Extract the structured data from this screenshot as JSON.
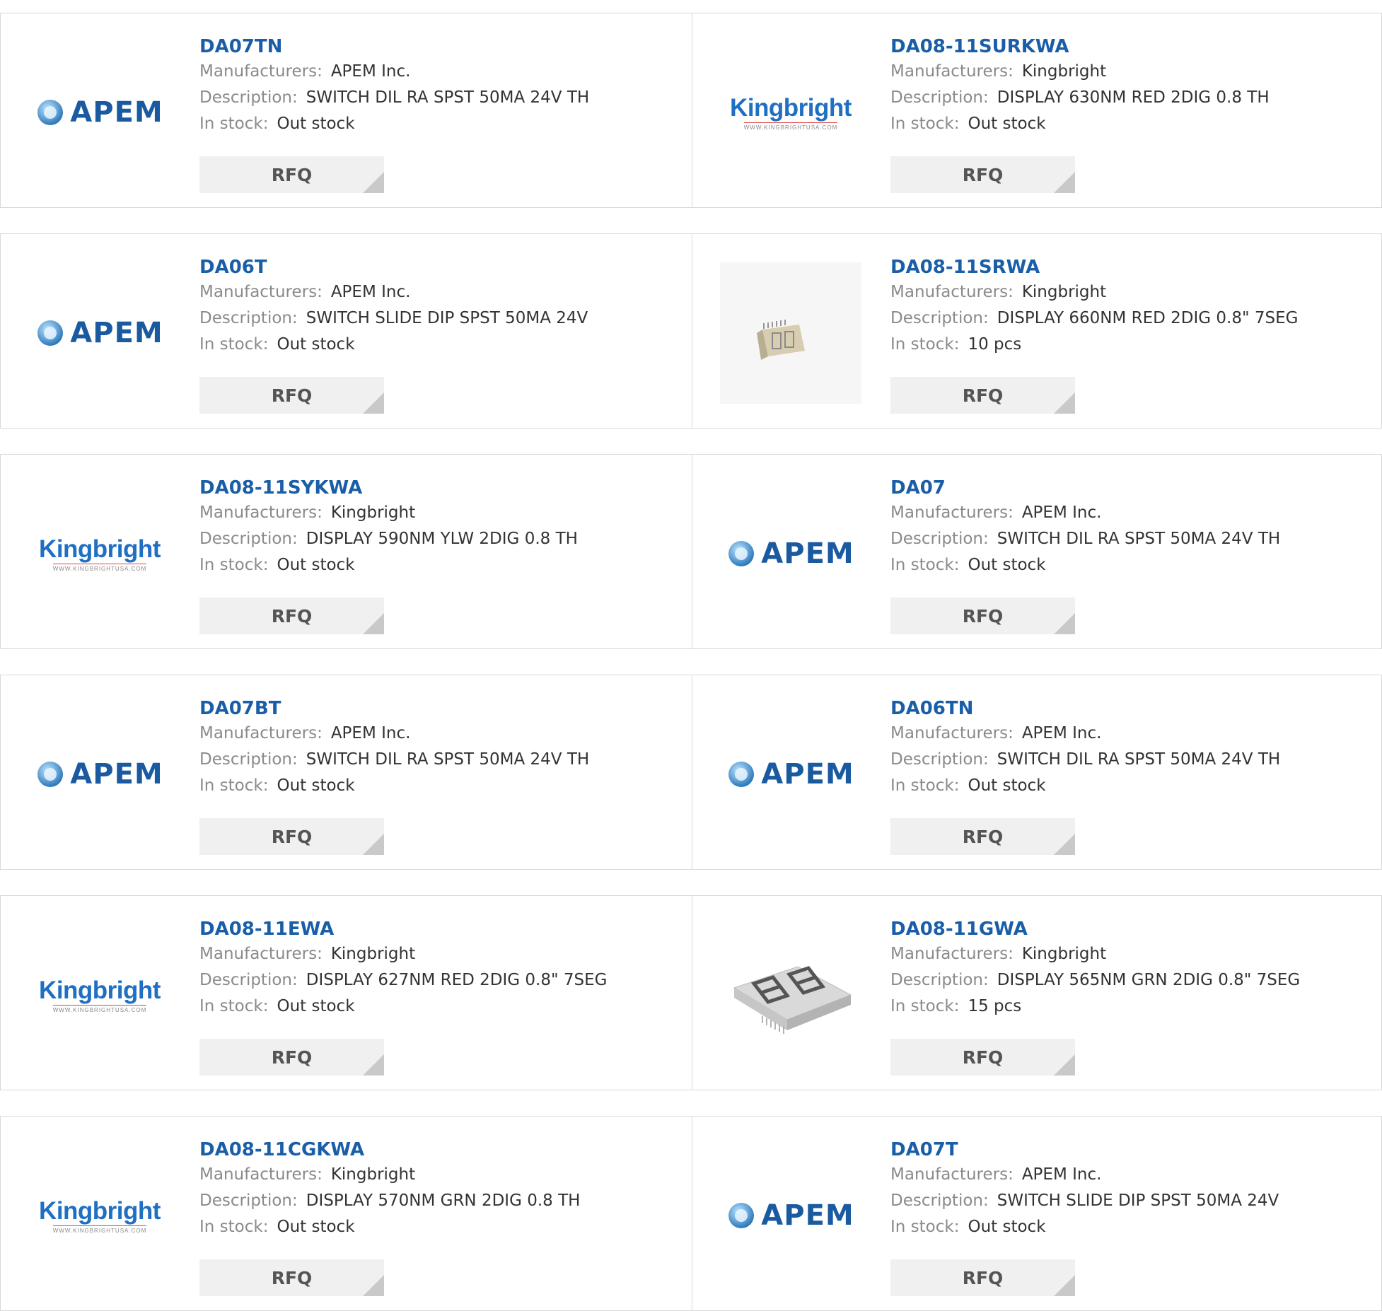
{
  "labels": {
    "manufacturers": "Manufacturers:",
    "description": "Description:",
    "in_stock": "In stock:",
    "rfq": "RFQ"
  },
  "products": [
    {
      "part": "DA07TN",
      "manufacturer": "APEM Inc.",
      "description": "SWITCH DIL RA SPST 50MA 24V TH",
      "stock": "Out stock",
      "logo": "apem-logo"
    },
    {
      "part": "DA08-11SURKWA",
      "manufacturer": "Kingbright",
      "description": "DISPLAY 630NM RED 2DIG 0.8 TH",
      "stock": "Out stock",
      "logo": "kingbright-logo"
    },
    {
      "part": "DA06T",
      "manufacturer": "APEM Inc.",
      "description": "SWITCH SLIDE DIP SPST 50MA 24V",
      "stock": "Out stock",
      "logo": "apem-logo"
    },
    {
      "part": "DA08-11SRWA",
      "manufacturer": "Kingbright",
      "description": "DISPLAY 660NM RED 2DIG 0.8\" 7SEG",
      "stock": "10 pcs",
      "logo": "small-display-photo"
    },
    {
      "part": "DA08-11SYKWA",
      "manufacturer": "Kingbright",
      "description": "DISPLAY 590NM YLW 2DIG 0.8 TH",
      "stock": "Out stock",
      "logo": "kingbright-logo"
    },
    {
      "part": "DA07",
      "manufacturer": "APEM Inc.",
      "description": "SWITCH DIL RA SPST 50MA 24V TH",
      "stock": "Out stock",
      "logo": "apem-logo"
    },
    {
      "part": "DA07BT",
      "manufacturer": "APEM Inc.",
      "description": "SWITCH DIL RA SPST 50MA 24V TH",
      "stock": "Out stock",
      "logo": "apem-logo"
    },
    {
      "part": "DA06TN",
      "manufacturer": "APEM Inc.",
      "description": "SWITCH DIL RA SPST 50MA 24V TH",
      "stock": "Out stock",
      "logo": "apem-logo"
    },
    {
      "part": "DA08-11EWA",
      "manufacturer": "Kingbright",
      "description": "DISPLAY 627NM RED 2DIG 0.8\" 7SEG",
      "stock": "Out stock",
      "logo": "kingbright-logo"
    },
    {
      "part": "DA08-11GWA",
      "manufacturer": "Kingbright",
      "description": "DISPLAY 565NM GRN 2DIG 0.8\" 7SEG",
      "stock": "15 pcs",
      "logo": "large-display-photo"
    },
    {
      "part": "DA08-11CGKWA",
      "manufacturer": "Kingbright",
      "description": "DISPLAY 570NM GRN 2DIG 0.8 TH",
      "stock": "Out stock",
      "logo": "kingbright-logo"
    },
    {
      "part": "DA07T",
      "manufacturer": "APEM Inc.",
      "description": "SWITCH SLIDE DIP SPST 50MA 24V",
      "stock": "Out stock",
      "logo": "apem-logo"
    }
  ],
  "logos": {
    "apem_text": "APEM",
    "kingbright_text": "Kingbright",
    "kingbright_url": "WWW.KINGBRIGHTUSA.COM"
  },
  "colors": {
    "part_link": "#1a5ea8",
    "label": "#8a8a8a",
    "value": "#333333",
    "rfq_bg": "#f0f0f0",
    "border": "#d9d9d9"
  }
}
